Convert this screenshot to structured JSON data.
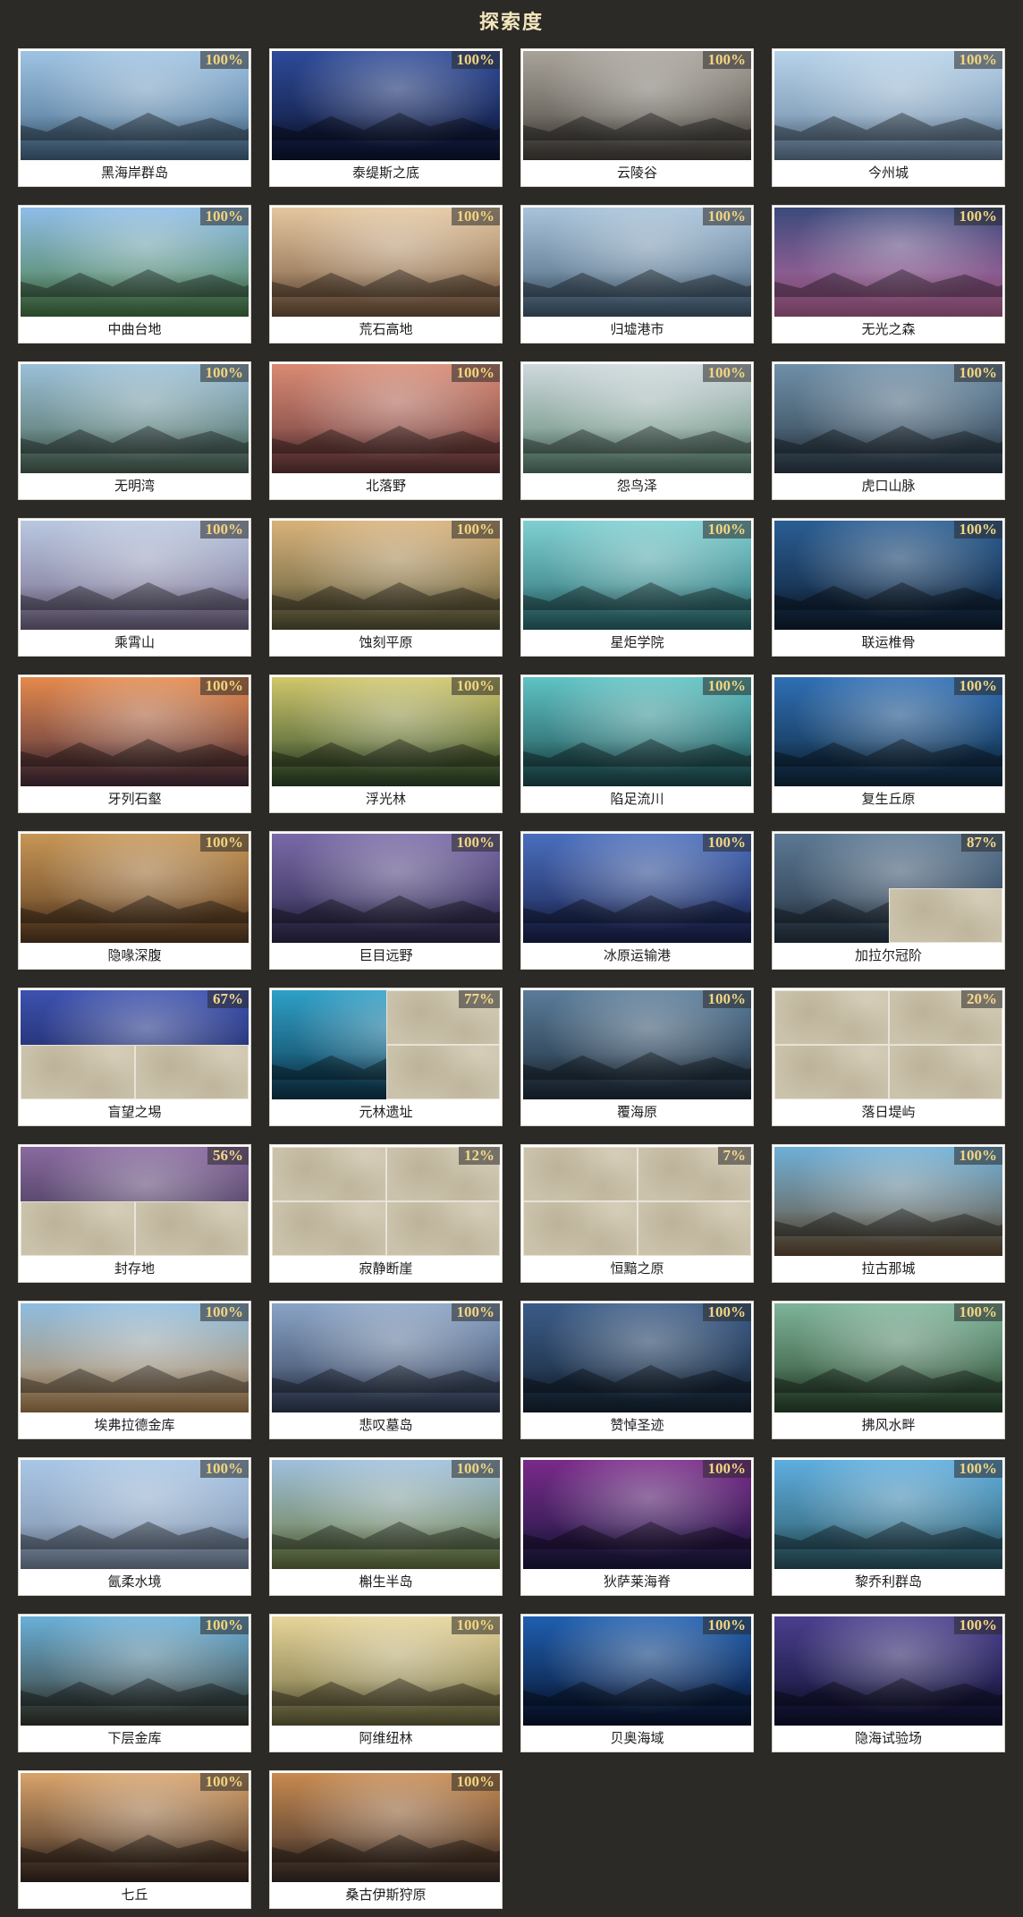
{
  "page": {
    "title": "探索度"
  },
  "regions": [
    {
      "name": "黑海岸群岛",
      "progress": "100%",
      "c1": "#9fc3e3",
      "c2": "#4a6f8e",
      "fog": []
    },
    {
      "name": "泰缇斯之底",
      "progress": "100%",
      "c1": "#2e4b9a",
      "c2": "#0d1533",
      "fog": []
    },
    {
      "name": "云陵谷",
      "progress": "100%",
      "c1": "#a9a39a",
      "c2": "#4a4640",
      "fog": []
    },
    {
      "name": "今州城",
      "progress": "100%",
      "c1": "#b7d3ea",
      "c2": "#6a86a2",
      "fog": []
    },
    {
      "name": "中曲台地",
      "progress": "100%",
      "c1": "#8fbde8",
      "c2": "#4b7f48",
      "fog": []
    },
    {
      "name": "荒石高地",
      "progress": "100%",
      "c1": "#e4c7a0",
      "c2": "#7a5a40",
      "fog": []
    },
    {
      "name": "归墟港市",
      "progress": "100%",
      "c1": "#a8c3da",
      "c2": "#47627a",
      "fog": []
    },
    {
      "name": "无光之森",
      "progress": "100%",
      "c1": "#3b4a7c",
      "c2": "#c06a9f",
      "fog": []
    },
    {
      "name": "无明湾",
      "progress": "100%",
      "c1": "#9bc0d8",
      "c2": "#4f6b5a",
      "fog": []
    },
    {
      "name": "北落野",
      "progress": "100%",
      "c1": "#d98b74",
      "c2": "#6a3a3c",
      "fog": []
    },
    {
      "name": "怨鸟泽",
      "progress": "100%",
      "c1": "#cfd9dd",
      "c2": "#5e8674",
      "fog": []
    },
    {
      "name": "虎口山脉",
      "progress": "100%",
      "c1": "#6f8fa8",
      "c2": "#30404e",
      "fog": []
    },
    {
      "name": "乘霄山",
      "progress": "100%",
      "c1": "#b9c8e0",
      "c2": "#7a6d8e",
      "fog": []
    },
    {
      "name": "蚀刻平原",
      "progress": "100%",
      "c1": "#d9b27a",
      "c2": "#5d5a3a",
      "fog": []
    },
    {
      "name": "星炬学院",
      "progress": "100%",
      "c1": "#7fd0d2",
      "c2": "#2c6e73",
      "fog": []
    },
    {
      "name": "联运椎骨",
      "progress": "100%",
      "c1": "#2a5e94",
      "c2": "#0f1f33",
      "fog": []
    },
    {
      "name": "牙列石壑",
      "progress": "100%",
      "c1": "#e5894c",
      "c2": "#4a2f3d",
      "fog": []
    },
    {
      "name": "浮光林",
      "progress": "100%",
      "c1": "#d1c76c",
      "c2": "#2f4a2a",
      "fog": []
    },
    {
      "name": "陷足流川",
      "progress": "100%",
      "c1": "#5fc3c4",
      "c2": "#1e4e52",
      "fog": []
    },
    {
      "name": "复生丘原",
      "progress": "100%",
      "c1": "#2f6fb5",
      "c2": "#0f2a40",
      "fog": []
    },
    {
      "name": "隐喙深腹",
      "progress": "100%",
      "c1": "#c79656",
      "c2": "#5e3e22",
      "fog": []
    },
    {
      "name": "巨目远野",
      "progress": "100%",
      "c1": "#7a6aa8",
      "c2": "#2e2a4e",
      "fog": []
    },
    {
      "name": "冰原运输港",
      "progress": "100%",
      "c1": "#4a6fbe",
      "c2": "#1a2350",
      "fog": []
    },
    {
      "name": "加拉尔冠阶",
      "progress": "87%",
      "c1": "#5b7893",
      "c2": "#2a3848",
      "fog": [
        3
      ]
    },
    {
      "name": "盲望之埸",
      "progress": "67%",
      "c1": "#3d52b0",
      "c2": "#141b4a",
      "fog": [
        2,
        3
      ]
    },
    {
      "name": "元林遗址",
      "progress": "77%",
      "c1": "#2fa0c8",
      "c2": "#0f3a52",
      "fog": [
        1,
        3
      ]
    },
    {
      "name": "覆海原",
      "progress": "100%",
      "c1": "#5a7c9a",
      "c2": "#1f2e3c",
      "fog": []
    },
    {
      "name": "落日堤屿",
      "progress": "20%",
      "c1": "#8a8170",
      "c2": "#4a4538",
      "fog": [
        0,
        1,
        2,
        3
      ]
    },
    {
      "name": "封存地",
      "progress": "56%",
      "c1": "#8a6aa0",
      "c2": "#2e2a40",
      "fog": [
        2,
        3
      ]
    },
    {
      "name": "寂静断崖",
      "progress": "12%",
      "c1": "#8a8170",
      "c2": "#4a4538",
      "fog": [
        0,
        1,
        2,
        3
      ]
    },
    {
      "name": "恒黯之原",
      "progress": "7%",
      "c1": "#8a8170",
      "c2": "#4a4538",
      "fog": [
        0,
        1,
        2,
        3
      ]
    },
    {
      "name": "拉古那城",
      "progress": "100%",
      "c1": "#6fb0d8",
      "c2": "#6a5238",
      "fog": []
    },
    {
      "name": "埃弗拉德金库",
      "progress": "100%",
      "c1": "#8fbde0",
      "c2": "#b98a55",
      "fog": []
    },
    {
      "name": "悲叹墓岛",
      "progress": "100%",
      "c1": "#8aa4c6",
      "c2": "#34405a",
      "fog": []
    },
    {
      "name": "赞悼圣迹",
      "progress": "100%",
      "c1": "#3b5c88",
      "c2": "#162536",
      "fog": []
    },
    {
      "name": "拂风水畔",
      "progress": "100%",
      "c1": "#7eb49a",
      "c2": "#2d4a30",
      "fog": []
    },
    {
      "name": "氤柔水境",
      "progress": "100%",
      "c1": "#a9c7e6",
      "c2": "#7f8fa8",
      "fog": []
    },
    {
      "name": "槲生半岛",
      "progress": "100%",
      "c1": "#9fc0dd",
      "c2": "#6b7a40",
      "fog": []
    },
    {
      "name": "狄萨莱海脊",
      "progress": "100%",
      "c1": "#7a2a8a",
      "c2": "#1a1840",
      "fog": []
    },
    {
      "name": "黎乔利群岛",
      "progress": "100%",
      "c1": "#5eaee0",
      "c2": "#2d5a66",
      "fog": []
    },
    {
      "name": "下层金库",
      "progress": "100%",
      "c1": "#6ab0d8",
      "c2": "#3a3a30",
      "fog": []
    },
    {
      "name": "阿维纽林",
      "progress": "100%",
      "c1": "#e7d59a",
      "c2": "#6f6a40",
      "fog": []
    },
    {
      "name": "贝奥海域",
      "progress": "100%",
      "c1": "#1f5fb0",
      "c2": "#081430",
      "fog": []
    },
    {
      "name": "隐海试验场",
      "progress": "100%",
      "c1": "#4a3f8e",
      "c2": "#0f1030",
      "fog": []
    },
    {
      "name": "七丘",
      "progress": "100%",
      "c1": "#d9a36a",
      "c2": "#3a2a22",
      "fog": []
    },
    {
      "name": "桑古伊斯狩原",
      "progress": "100%",
      "c1": "#c88a50",
      "c2": "#3a2e2a",
      "fog": []
    }
  ]
}
